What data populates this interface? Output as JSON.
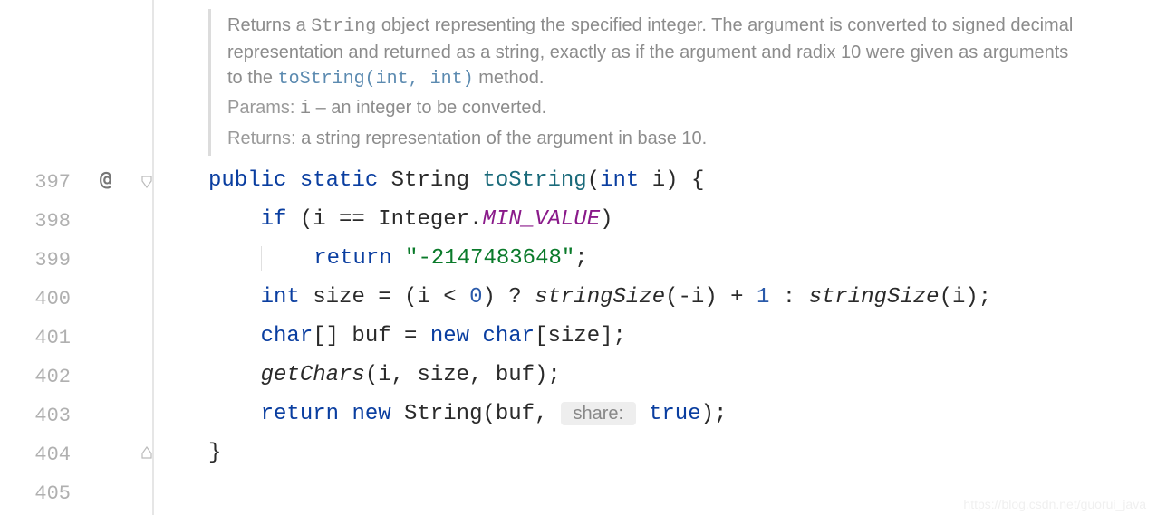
{
  "doc": {
    "desc_pre": "Returns a ",
    "desc_code": "String",
    "desc_mid": " object representing the specified integer. The argument is converted to signed decimal representation and returned as a string, exactly as if the argument and radix 10 were given as arguments to the ",
    "desc_link": "toString(int, int)",
    "desc_post": " method.",
    "params_label": "Params:",
    "params_name": "i",
    "params_sep": " – ",
    "params_desc": "an integer to be converted.",
    "returns_label": "Returns:",
    "returns_desc": "a string representation of the argument in base 10."
  },
  "lines": {
    "n397": "397",
    "n398": "398",
    "n399": "399",
    "n400": "400",
    "n401": "401",
    "n402": "402",
    "n403": "403",
    "n404": "404",
    "n405": "405"
  },
  "code": {
    "l397": {
      "kw_public": "public",
      "kw_static": "static",
      "type": "String",
      "meth": "toString",
      "paren_open": "(",
      "kw_int": "int",
      "param": " i",
      "paren_close": ")",
      "brace": " {"
    },
    "l398": {
      "kw_if": "if",
      "open": " (i == Integer.",
      "const": "MIN_VALUE",
      "close": ")"
    },
    "l399": {
      "kw_return": "return",
      "sp": " ",
      "str": "\"-2147483648\"",
      "semi": ";"
    },
    "l400": {
      "kw_int": "int",
      "text1": " size = (i < ",
      "zero": "0",
      "text2": ") ? ",
      "fn1": "stringSize",
      "text3": "(-i) + ",
      "one": "1",
      "text4": " : ",
      "fn2": "stringSize",
      "text5": "(i);"
    },
    "l401": {
      "kw_char": "char",
      "text1": "[] buf = ",
      "kw_new": "new",
      "sp": " ",
      "kw_char2": "char",
      "text2": "[size];"
    },
    "l402": {
      "fn": "getChars",
      "args": "(i, size, buf);"
    },
    "l403": {
      "kw_return": "return",
      "sp": " ",
      "kw_new": "new",
      "text1": " String(buf, ",
      "hint": " share: ",
      "kw_true": "true",
      "text2": ");"
    },
    "l404": {
      "brace": "}"
    }
  },
  "gutter_at": "@",
  "watermark": "https://blog.csdn.net/guorui_java"
}
